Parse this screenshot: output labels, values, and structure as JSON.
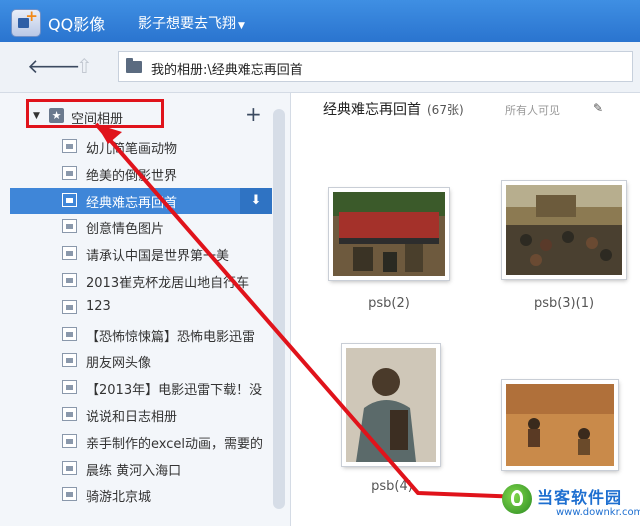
{
  "app": {
    "title": "QQ影像",
    "user": "影子想要去飞翔"
  },
  "toolbar": {
    "path": "我的相册:\\经典难忘再回首"
  },
  "sidebar": {
    "group_label": "空间相册",
    "add_label": "+",
    "albums": [
      {
        "label": "幼儿简笔画动物"
      },
      {
        "label": "绝美的倒影世界"
      },
      {
        "label": "经典难忘再回首",
        "selected": true
      },
      {
        "label": "创意情色图片"
      },
      {
        "label": "请承认中国是世界第一美"
      },
      {
        "label": "2013崔克杯龙居山地自行车"
      },
      {
        "label": "123"
      },
      {
        "label": "【恐怖惊悚篇】恐怖电影迅雷"
      },
      {
        "label": "朋友网头像"
      },
      {
        "label": "【2013年】电影迅雷下载！没"
      },
      {
        "label": "说说和日志相册"
      },
      {
        "label": "亲手制作的excel动画，需要的"
      },
      {
        "label": "晨练 黄河入海口"
      },
      {
        "label": "骑游北京城"
      }
    ]
  },
  "content": {
    "album_title": "经典难忘再回首",
    "count": "(67张)",
    "visibility": "所有人可见",
    "photos": [
      {
        "label": "psb(2)"
      },
      {
        "label": "psb(3)(1)"
      },
      {
        "label": "psb(4)"
      },
      {
        "label": ""
      }
    ]
  },
  "icons": {
    "back": "arrow-left-icon",
    "up": "folder-up-icon",
    "download": "download-icon",
    "edit": "pencil-icon"
  },
  "colors": {
    "titlebar": "#2f7fdc",
    "selection": "#3f86d8",
    "annotation": "#e0131b"
  },
  "watermark": {
    "name": "当客软件园",
    "url": "www.downkr.com"
  }
}
